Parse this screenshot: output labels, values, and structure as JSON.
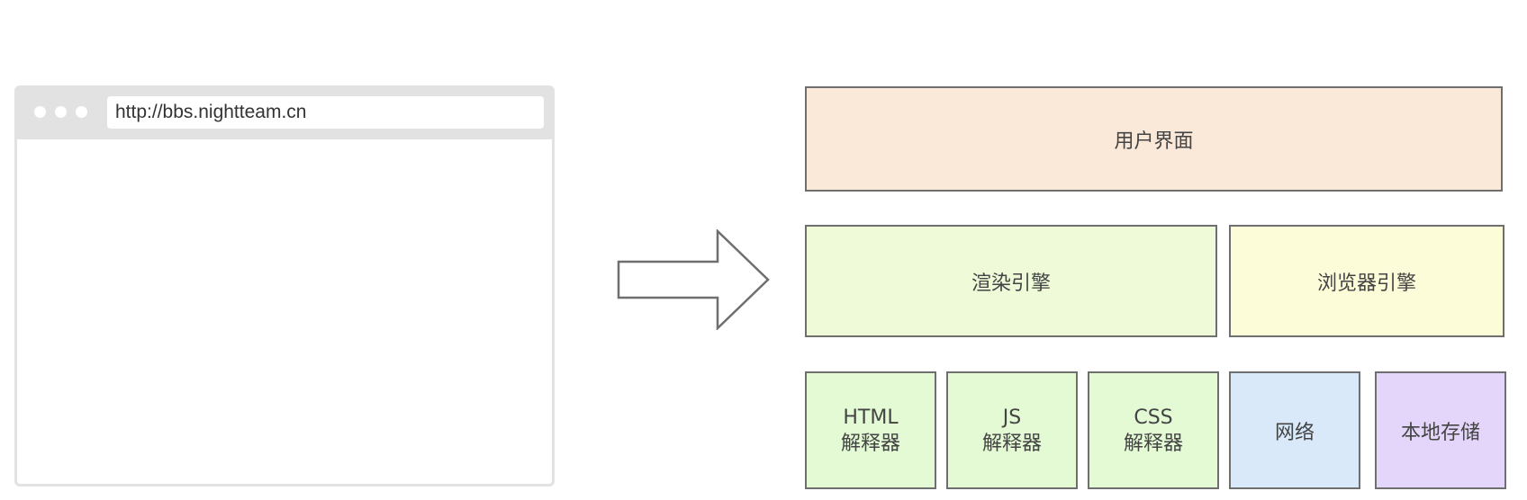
{
  "browser": {
    "url": "http://bbs.nightteam.cn"
  },
  "architecture": {
    "ui": {
      "label": "用户界面",
      "color": "#fae9d9"
    },
    "render": {
      "label": "渲染引擎",
      "color": "#eefad8"
    },
    "browser": {
      "label": "浏览器引擎",
      "color": "#fdfcd8"
    },
    "html": {
      "top": "HTML",
      "bottom": "解释器",
      "color": "#e3fad5"
    },
    "js": {
      "top": "JS",
      "bottom": "解释器",
      "color": "#e3fad5"
    },
    "css": {
      "top": "CSS",
      "bottom": "解释器",
      "color": "#e3fad5"
    },
    "network": {
      "label": "网络",
      "color": "#d9e9fa"
    },
    "storage": {
      "label": "本地存储",
      "color": "#e4d6fb"
    }
  },
  "colors": {
    "border": "#6f6f6f",
    "browser_chrome": "#e2e2e2"
  }
}
